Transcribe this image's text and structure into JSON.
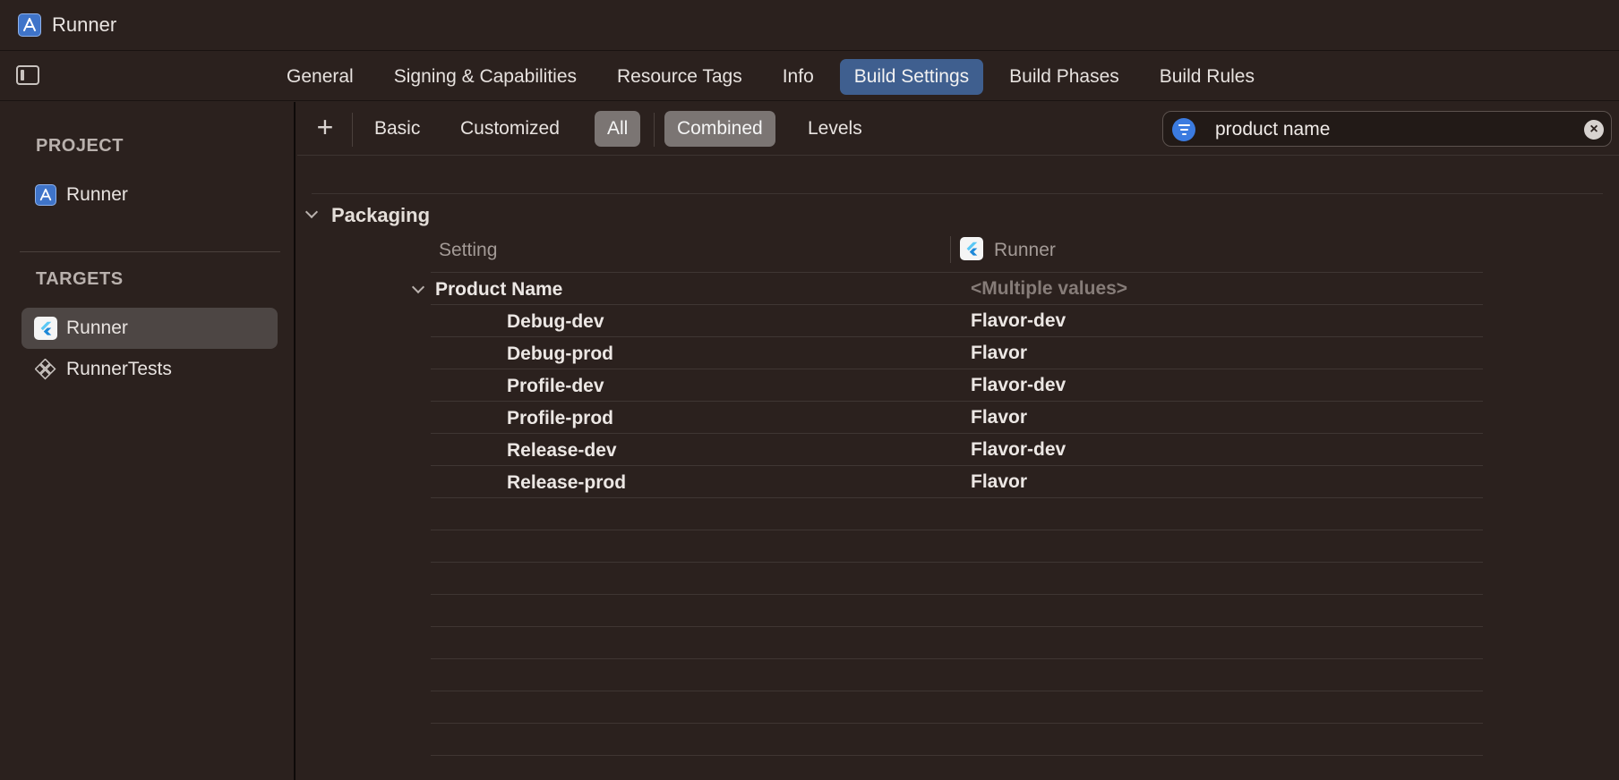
{
  "window": {
    "title": "Runner"
  },
  "tabs": [
    {
      "label": "General",
      "active": false
    },
    {
      "label": "Signing & Capabilities",
      "active": false
    },
    {
      "label": "Resource Tags",
      "active": false
    },
    {
      "label": "Info",
      "active": false
    },
    {
      "label": "Build Settings",
      "active": true
    },
    {
      "label": "Build Phases",
      "active": false
    },
    {
      "label": "Build Rules",
      "active": false
    }
  ],
  "sidebar": {
    "project_label": "PROJECT",
    "project_item": "Runner",
    "targets_label": "TARGETS",
    "targets": [
      {
        "label": "Runner",
        "selected": true,
        "icon": "flutter-icon"
      },
      {
        "label": "RunnerTests",
        "selected": false,
        "icon": "test-target-icon"
      }
    ]
  },
  "filter": {
    "add": "+",
    "basic": "Basic",
    "customized": "Customized",
    "all": "All",
    "combined": "Combined",
    "levels": "Levels",
    "search_value": "product name"
  },
  "settings": {
    "group_title": "Packaging",
    "col_setting": "Setting",
    "col_target": "Runner",
    "setting_name": "Product Name",
    "setting_summary": "<Multiple values>",
    "configs": [
      {
        "name": "Debug-dev",
        "value": "Flavor-dev"
      },
      {
        "name": "Debug-prod",
        "value": "Flavor"
      },
      {
        "name": "Profile-dev",
        "value": "Flavor-dev"
      },
      {
        "name": "Profile-prod",
        "value": "Flavor"
      },
      {
        "name": "Release-dev",
        "value": "Flavor-dev"
      },
      {
        "name": "Release-prod",
        "value": "Flavor"
      }
    ]
  },
  "colors": {
    "background": "#2b211e",
    "active_tab": "#3f5f8f",
    "accent_blue": "#3b7be0",
    "selected_item": "#4d4644"
  }
}
